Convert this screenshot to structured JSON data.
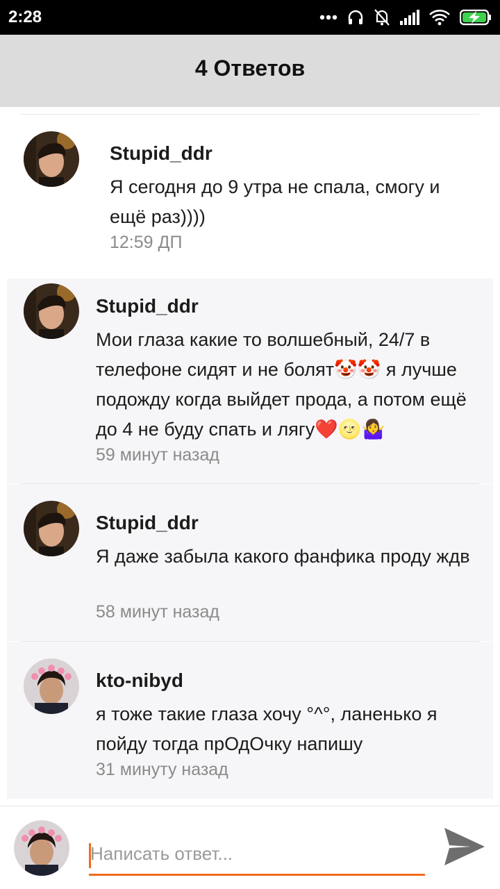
{
  "status_bar": {
    "time": "2:28",
    "icons": [
      "more-dots-icon",
      "headset-icon",
      "bell-off-icon",
      "signal-icon",
      "wifi-icon",
      "battery-charging-icon"
    ]
  },
  "header": {
    "title": "4 Ответов"
  },
  "main_comment": {
    "author": "Stupid_ddr",
    "text": "Я сегодня до 9 утра не спала, смогу и ещё раз))))",
    "time": "12:59 ДП"
  },
  "replies": [
    {
      "author": "Stupid_ddr",
      "text": "Мои глаза какие то волшебный, 24/7 в телефоне сидят и не болят🤡🤡 я лучше подожду когда выйдет прода, а потом ещё до 4 не буду спать и лягу❤️🌝🤷‍♀️",
      "time": "59 минут назад"
    },
    {
      "author": "Stupid_ddr",
      "text": "Я даже забыла какого фанфика проду ждв",
      "time": "58 минут назад"
    },
    {
      "author": "kto-nibyd",
      "text": "я тоже такие глаза хочу °^°, ланенько я пойду тогда прОдОчку напишу",
      "time": "31 минуту назад"
    }
  ],
  "composer": {
    "placeholder": "Написать ответ..."
  },
  "colors": {
    "accent": "#f26b1d",
    "header_bg": "#dcdcdc",
    "reply_bg": "#f6f6f8"
  }
}
